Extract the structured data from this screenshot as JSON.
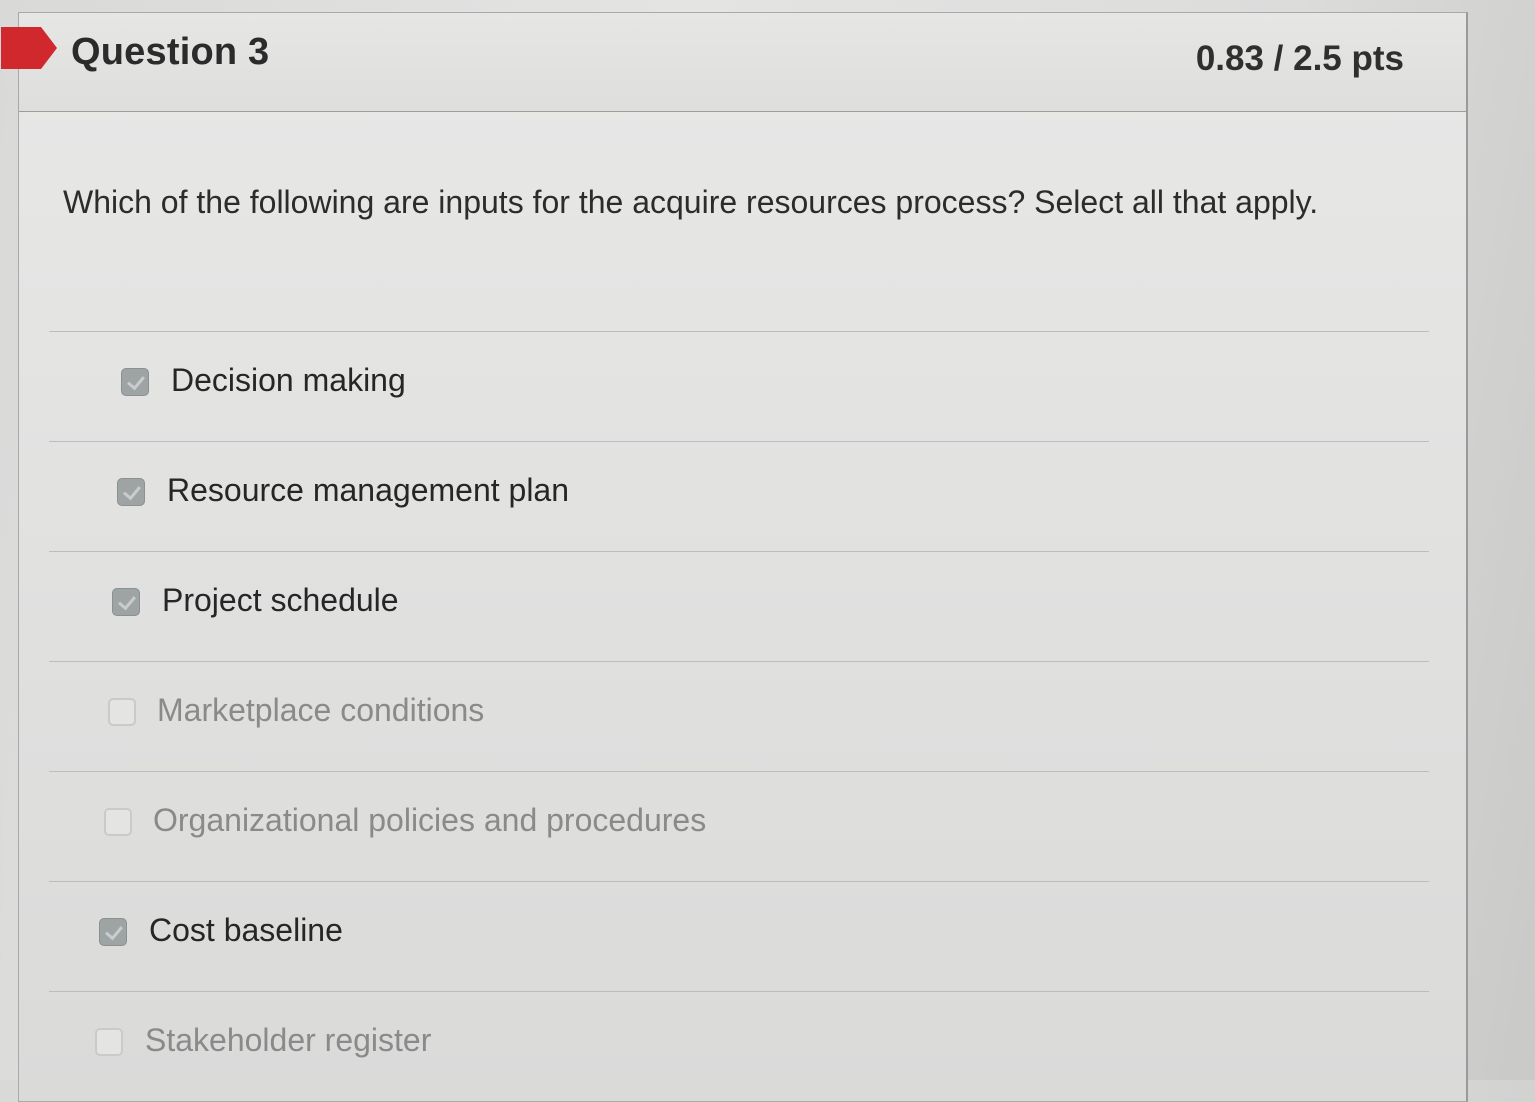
{
  "question": {
    "title": "Question 3",
    "points": "0.83 / 2.5 pts",
    "prompt": "Which of the following are inputs for the acquire resources process? Select all that apply.",
    "flag_color": "#d0282c"
  },
  "answers": [
    {
      "label": "Decision making",
      "checked": true
    },
    {
      "label": "Resource management plan",
      "checked": true
    },
    {
      "label": "Project schedule",
      "checked": true
    },
    {
      "label": "Marketplace conditions",
      "checked": false
    },
    {
      "label": "Organizational policies and procedures",
      "checked": false
    },
    {
      "label": "Cost baseline",
      "checked": true
    },
    {
      "label": "Stakeholder register",
      "checked": false
    }
  ]
}
